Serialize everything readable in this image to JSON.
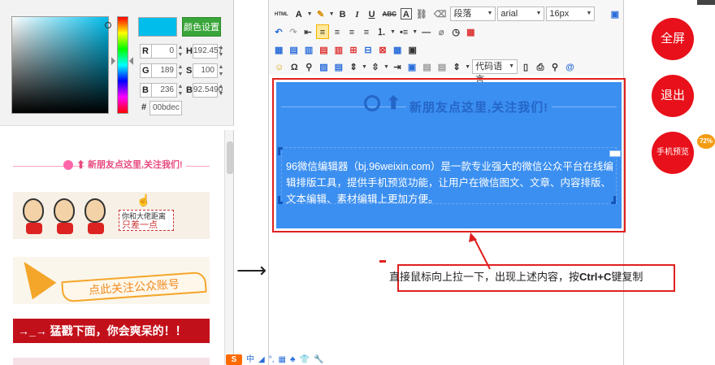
{
  "color_picker": {
    "set_color_label": "颜色设置",
    "fields": [
      {
        "label": "R",
        "value": "0"
      },
      {
        "label": "H",
        "value": "192.457"
      },
      {
        "label": "G",
        "value": "189"
      },
      {
        "label": "S",
        "value": "100"
      },
      {
        "label": "B",
        "value": "236"
      },
      {
        "label": "B",
        "value": "92.5490"
      }
    ],
    "hex_label": "#",
    "hex_value": "00bdec",
    "swatch_color": "#00bdec"
  },
  "templates": {
    "follow_banner": "新朋友点这里,关注我们!",
    "note_line1": "你和大佬距离",
    "note_line2": "只差一点",
    "plane_banner": "点此关注公众账号",
    "red_banner": "→_→ 猛戳下面，你会爽呆的！！"
  },
  "toolbar": {
    "html_label": "HTML",
    "font_color": "A",
    "bold": "B",
    "italic": "I",
    "underline": "U",
    "strike": "ABC",
    "paragraph_select": "段落",
    "font_select": "arial",
    "size_select": "16px",
    "code_lang_select": "代码语言",
    "omega": "Ω"
  },
  "content": {
    "banner_text": "新朋友点这里,关注我们!",
    "paragraph": "96微信编辑器（bj.96weixin.com）是一款专业强大的微信公众平台在线编辑排版工具，提供手机预览功能，让用户在微信图文、文章、内容排版、文本编辑、素材编辑上更加方便。"
  },
  "instruction": {
    "prefix": "直接鼠标向上拉一下，出现上述内容，按",
    "keys": "Ctrl+C",
    "suffix": "键复制"
  },
  "ime": {
    "logo": "S",
    "items": [
      "中",
      "◢",
      "°,",
      "▦",
      "♣",
      "👕",
      "🔧"
    ]
  },
  "side_buttons": {
    "fullscreen": "全屏",
    "exit": "退出",
    "preview": "手机预览",
    "badge": "72%"
  },
  "colors": {
    "accent_red": "#e8101a",
    "editor_blue": "#3b8ff0",
    "green_button": "#3aa53a"
  }
}
